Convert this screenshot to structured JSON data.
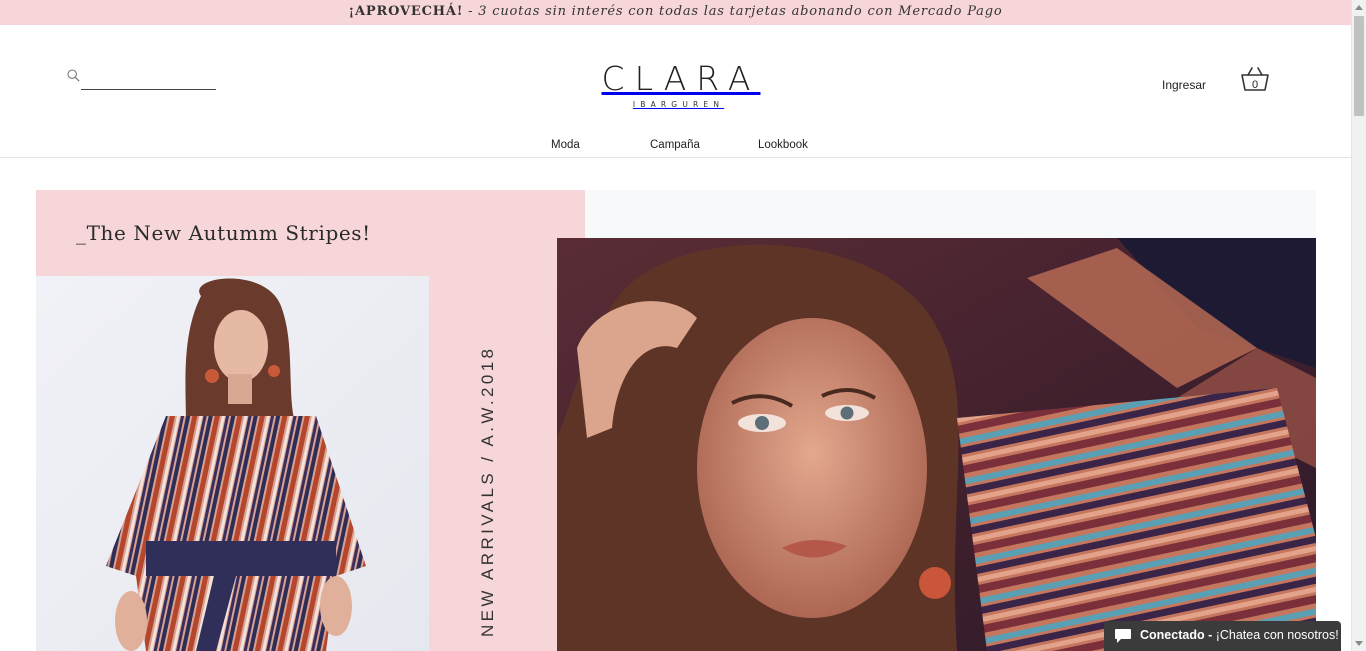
{
  "promo": {
    "strong": "¡APROVECHÁ!",
    "rest": " - 3 cuotas sin interés con todas las tarjetas abonando con Mercado Pago"
  },
  "header": {
    "search_value": "",
    "logo_main": "CLARA",
    "logo_sub": "IBARGUREN",
    "login_label": "Ingresar",
    "cart_count": "0"
  },
  "nav": {
    "items": [
      {
        "label": "Moda"
      },
      {
        "label": "Campaña"
      },
      {
        "label": "Lookbook"
      }
    ]
  },
  "hero": {
    "title": "_The New Autumm Stripes!",
    "vertical_text": "NEW ARRIVALS / A.W.2018"
  },
  "chat": {
    "status": "Conectado",
    "separator": " - ",
    "message": "¡Chatea con nosotros!"
  },
  "colors": {
    "accent_pink": "#f7d6d9",
    "chat_bg": "#3b3b3b"
  },
  "icons": {
    "search": "search-icon",
    "cart": "shopping-basket-icon",
    "chat": "chat-bubble-icon"
  }
}
